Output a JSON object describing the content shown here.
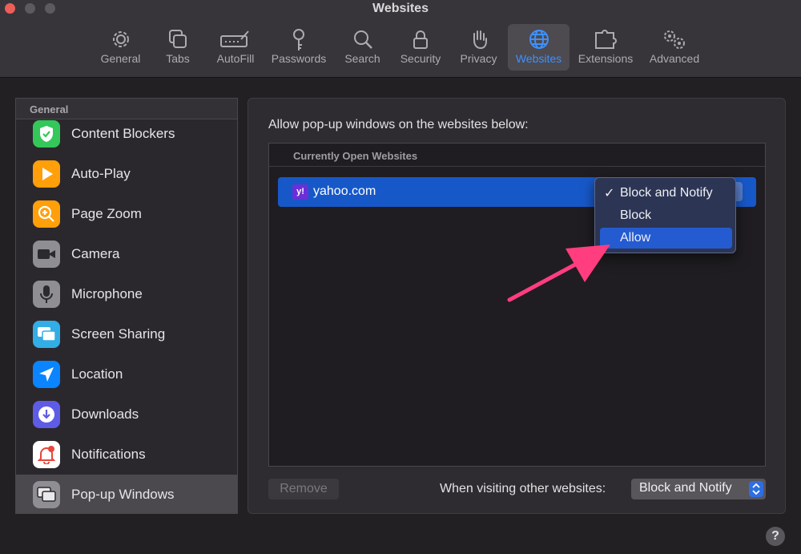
{
  "window": {
    "title": "Websites"
  },
  "toolbar": {
    "tabs": [
      {
        "label": "General",
        "icon": "gear-icon"
      },
      {
        "label": "Tabs",
        "icon": "tabs-icon"
      },
      {
        "label": "AutoFill",
        "icon": "autofill-icon"
      },
      {
        "label": "Passwords",
        "icon": "key-icon"
      },
      {
        "label": "Search",
        "icon": "search-icon"
      },
      {
        "label": "Security",
        "icon": "lock-icon"
      },
      {
        "label": "Privacy",
        "icon": "hand-icon"
      },
      {
        "label": "Websites",
        "icon": "globe-icon",
        "active": true
      },
      {
        "label": "Extensions",
        "icon": "puzzle-icon"
      },
      {
        "label": "Advanced",
        "icon": "gears-icon"
      }
    ]
  },
  "sidebar": {
    "header": "General",
    "items": [
      {
        "label": "Content Blockers",
        "icon": "shield-check-icon",
        "color": "#34c759"
      },
      {
        "label": "Auto-Play",
        "icon": "play-icon",
        "color": "#ff9f0a"
      },
      {
        "label": "Page Zoom",
        "icon": "zoom-icon",
        "color": "#ff9f0a"
      },
      {
        "label": "Camera",
        "icon": "camera-icon",
        "color": "#8e8e93"
      },
      {
        "label": "Microphone",
        "icon": "microphone-icon",
        "color": "#8e8e93"
      },
      {
        "label": "Screen Sharing",
        "icon": "screen-sharing-icon",
        "color": "#32ade6"
      },
      {
        "label": "Location",
        "icon": "location-arrow-icon",
        "color": "#0a84ff"
      },
      {
        "label": "Downloads",
        "icon": "download-icon",
        "color": "#5e5ce6"
      },
      {
        "label": "Notifications",
        "icon": "bell-icon",
        "color": "#ffffff"
      },
      {
        "label": "Pop-up Windows",
        "icon": "popup-windows-icon",
        "color": "#8e8e93",
        "selected": true
      }
    ]
  },
  "main": {
    "heading": "Allow pop-up windows on the websites below:",
    "list_header": "Currently Open Websites",
    "sites": [
      {
        "name": "yahoo.com",
        "icon": "yahoo-icon",
        "icon_text": "y!"
      }
    ],
    "remove_label": "Remove",
    "visit_label": "When visiting other websites:",
    "visit_value": "Block and Notify"
  },
  "dropdown": {
    "check": "✓",
    "options": [
      "Block and Notify",
      "Block",
      "Allow"
    ],
    "selected": "Block and Notify",
    "highlighted": "Allow"
  },
  "help": {
    "label": "?"
  },
  "colors": {
    "accent": "#3d91ff",
    "annotation_arrow": "#ff3d7f"
  }
}
